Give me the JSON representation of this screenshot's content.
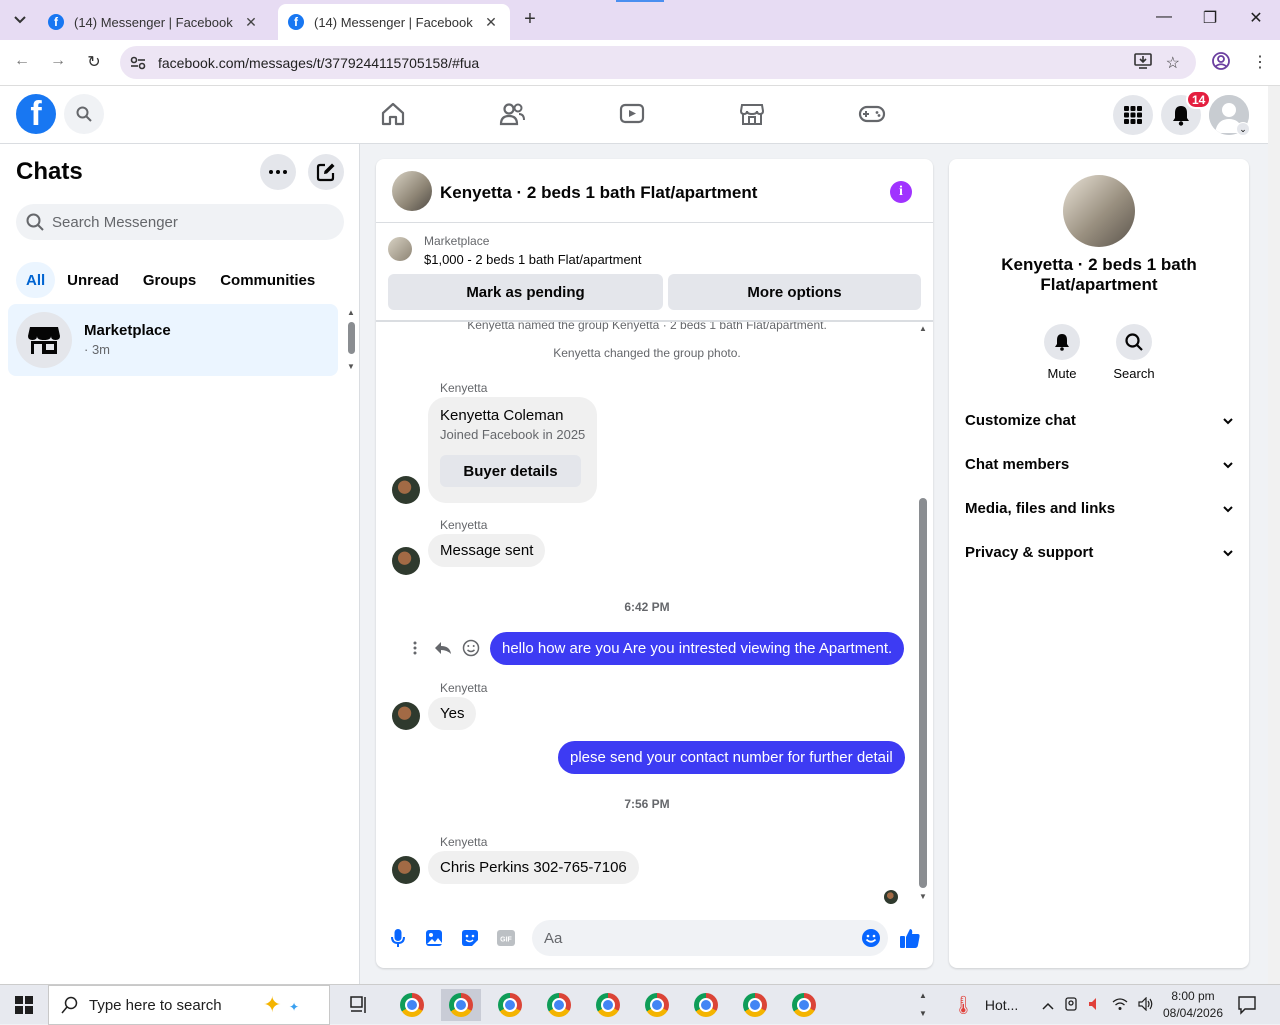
{
  "browser": {
    "tabs": [
      {
        "title": "(14) Messenger | Facebook",
        "active": false
      },
      {
        "title": "(14) Messenger | Facebook",
        "active": true
      }
    ],
    "url": "facebook.com/messages/t/3779244115705158/#fua"
  },
  "header": {
    "notifications_count": "14",
    "brand_color": "#1877f2"
  },
  "sidebar": {
    "title": "Chats",
    "search_placeholder": "Search Messenger",
    "filters": [
      "All",
      "Unread",
      "Groups",
      "Communities"
    ],
    "chats": [
      {
        "name": "Marketplace",
        "time": "· 3m"
      }
    ]
  },
  "conversation": {
    "title": "Kenyetta · 2 beds 1 bath Flat/apartment",
    "marketplace": {
      "label": "Marketplace",
      "listing": "$1,000 - 2 beds 1 bath Flat/apartment",
      "pending_button": "Mark as pending",
      "options_button": "More options"
    },
    "system_messages": [
      "Kenyetta named the group Kenyetta · 2 beds 1 bath Flat/apartment.",
      "Kenyetta changed the group photo."
    ],
    "sender_name": "Kenyetta",
    "buyer_card": {
      "name": "Kenyetta Coleman",
      "joined": "Joined Facebook in 2025",
      "button": "Buyer details"
    },
    "messages": [
      {
        "direction": "in",
        "text": "Message sent"
      },
      {
        "direction": "timestamp",
        "text": "6:42 PM"
      },
      {
        "direction": "out",
        "text": "hello how are you Are you intrested viewing the Apartment."
      },
      {
        "direction": "in",
        "text": "Yes"
      },
      {
        "direction": "out",
        "text": "plese send your contact number for further detail"
      },
      {
        "direction": "timestamp",
        "text": "7:56 PM"
      },
      {
        "direction": "in",
        "text": "Chris Perkins 302-765-7106"
      }
    ],
    "composer_placeholder": "Aa",
    "outgoing_color": "#3d3bf3"
  },
  "info_panel": {
    "name": "Kenyetta · 2 beds 1 bath Flat/apartment",
    "actions": [
      "Mute",
      "Search"
    ],
    "sections": [
      "Customize chat",
      "Chat members",
      "Media, files and links",
      "Privacy & support"
    ]
  },
  "taskbar": {
    "search_placeholder": "Type here to search",
    "weather": "Hot...",
    "time": "8:00 pm",
    "date": "08/04/2026"
  }
}
